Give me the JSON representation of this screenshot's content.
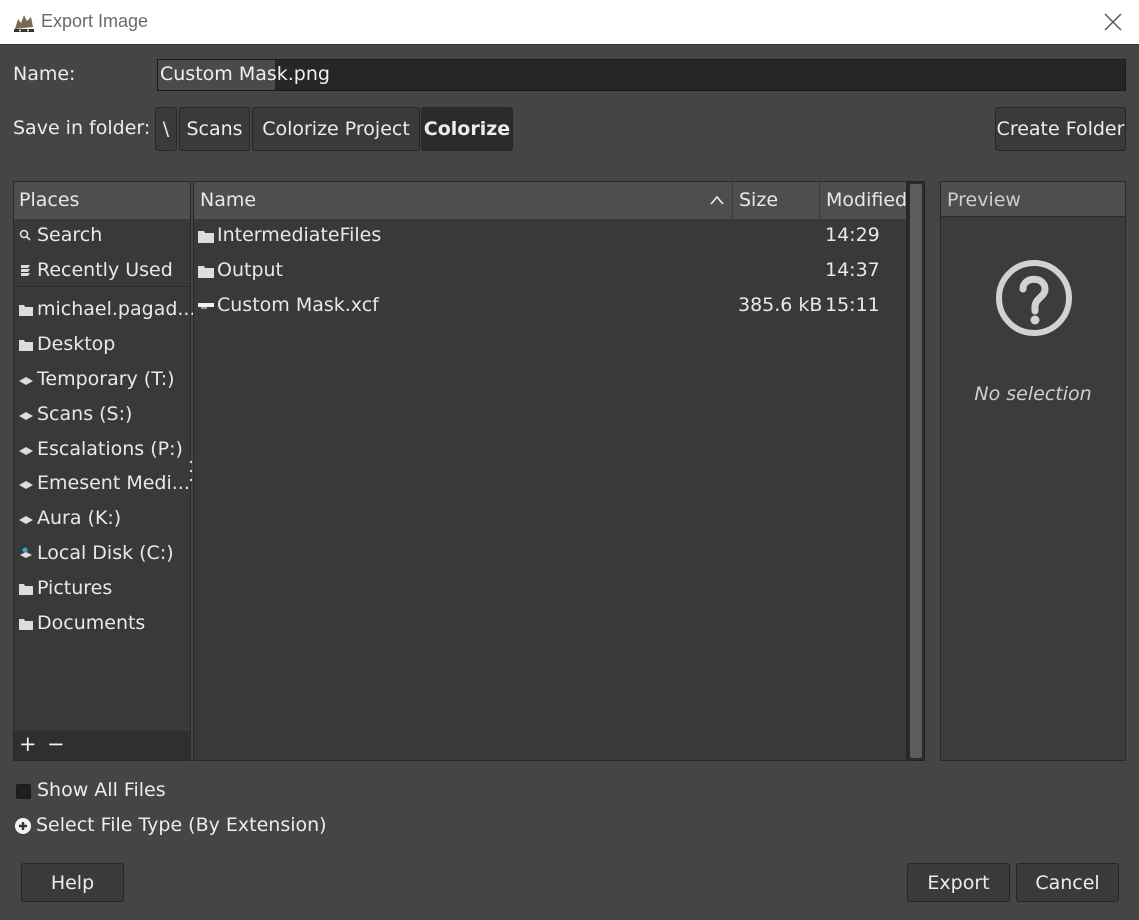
{
  "window": {
    "title": "Export Image"
  },
  "name_row": {
    "label": "Name:",
    "value": "Custom Mask.png",
    "selected_text": "Custom Mask"
  },
  "folder_row": {
    "label": "Save in folder:",
    "breadcrumbs": [
      "\\",
      "Scans",
      "Colorize Project",
      "Colorize"
    ],
    "active_crumb": "Colorize",
    "create_folder": "Create Folder"
  },
  "places": {
    "header": "Places",
    "items": [
      {
        "label": "Search",
        "icon": "search-icon"
      },
      {
        "label": "Recently Used",
        "icon": "recent-icon"
      },
      {
        "label": "michael.pagad...",
        "icon": "folder-icon"
      },
      {
        "label": "Desktop",
        "icon": "folder-icon"
      },
      {
        "label": "Temporary (T:)",
        "icon": "drive-icon"
      },
      {
        "label": "Scans (S:)",
        "icon": "drive-icon"
      },
      {
        "label": "Escalations (P:)",
        "icon": "drive-icon"
      },
      {
        "label": "Emesent Medi...",
        "icon": "drive-icon"
      },
      {
        "label": "Aura (K:)",
        "icon": "drive-icon"
      },
      {
        "label": "Local Disk (C:)",
        "icon": "local-disk-icon"
      },
      {
        "label": "Pictures",
        "icon": "folder-icon"
      },
      {
        "label": "Documents",
        "icon": "folder-icon"
      }
    ],
    "add": "+",
    "remove": "−"
  },
  "file_list": {
    "columns": {
      "name": "Name",
      "size": "Size",
      "modified": "Modified"
    },
    "sort": "name-ascending",
    "rows": [
      {
        "name": "IntermediateFiles",
        "size": "",
        "modified": "14:29",
        "icon": "folder-icon"
      },
      {
        "name": "Output",
        "size": "",
        "modified": "14:37",
        "icon": "folder-icon"
      },
      {
        "name": "Custom Mask.xcf",
        "size": "385.6 kB",
        "modified": "15:11",
        "icon": "xcf-file-icon"
      }
    ]
  },
  "preview": {
    "header": "Preview",
    "empty_text": "No selection"
  },
  "options": {
    "show_all_files": "Show All Files",
    "show_all_checked": false,
    "select_file_type": "Select File Type (By Extension)"
  },
  "buttons": {
    "help": "Help",
    "export": "Export",
    "cancel": "Cancel"
  },
  "colors": {
    "background": "#454545",
    "panel": "#393939",
    "header": "#4e4e4e",
    "input": "#262626"
  }
}
